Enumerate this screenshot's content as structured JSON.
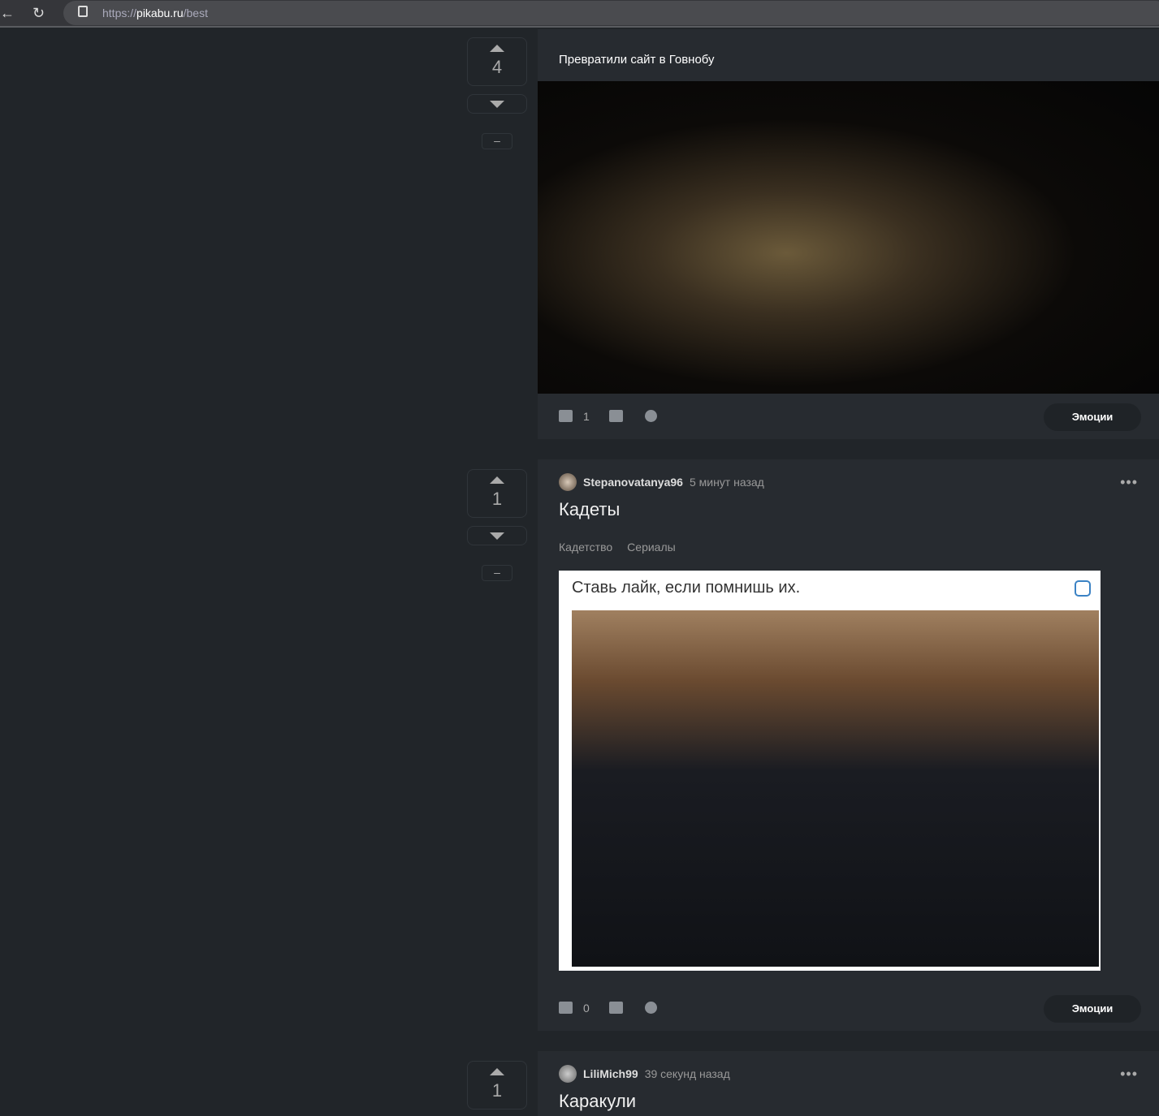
{
  "browser": {
    "url_prefix": "https://",
    "url_host": "pikabu.ru",
    "url_path": "/best"
  },
  "posts": [
    {
      "votes": "4",
      "title": "Превратили сайт в Говнобу",
      "comments": "1",
      "emotions": "Эмоции"
    },
    {
      "votes": "1",
      "author": "Stepanovatanya96",
      "time": "5 минут назад",
      "title": "Кадеты",
      "tags": [
        "Кадетство",
        "Сериалы"
      ],
      "image_caption": "Ставь лайк, если помнишь их.",
      "comments": "0",
      "emotions": "Эмоции"
    },
    {
      "votes": "1",
      "author": "LiliMich99",
      "time": "39 секунд назад",
      "title": "Каракули"
    }
  ],
  "vote_minus": "–"
}
